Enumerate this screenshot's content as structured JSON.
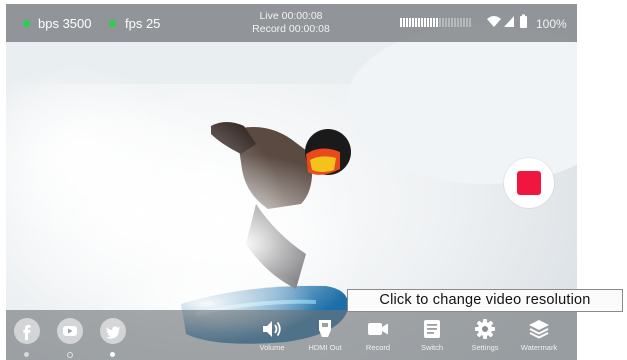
{
  "status_bar": {
    "bitrate": "bps 3500",
    "fps": "fps 25",
    "live_time": "Live 00:00:08",
    "record_time": "Record 00:00:08",
    "battery": "100%",
    "indicator_color": "#27d14a"
  },
  "record_button": {
    "icon": "record-stop-icon",
    "color": "#f0163f"
  },
  "social": [
    {
      "icon": "facebook-icon"
    },
    {
      "icon": "youtube-icon"
    },
    {
      "icon": "twitter-icon"
    }
  ],
  "toolbar": {
    "volume": "Volume",
    "hdmi_out": "HDMI Out",
    "record": "Record",
    "switch": "Switch",
    "settings": "Settings",
    "watermark": "Watermark"
  },
  "tooltip": {
    "text": "Click to change video resolution"
  }
}
